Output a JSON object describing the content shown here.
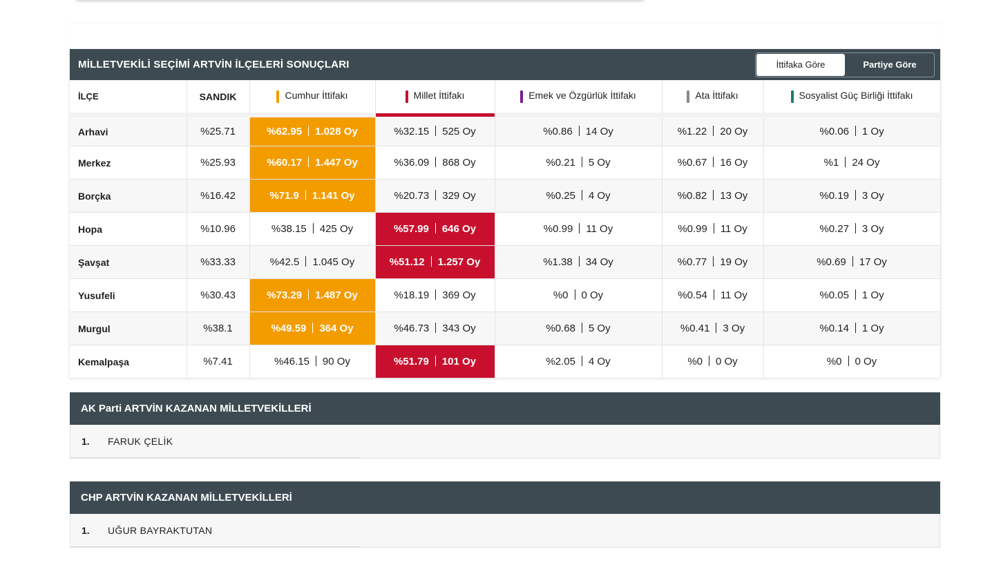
{
  "results": {
    "title": "MİLLETVEKİLİ SEÇİMİ ARTVİN İLÇELERİ SONUÇLARI",
    "toggle": [
      "İttifaka Göre",
      "Partiye Göre"
    ],
    "columns": {
      "district": "İLÇE",
      "ballot": "SANDIK",
      "alliances": [
        {
          "name": "Cumhur İttifakı",
          "color": "#f39c00"
        },
        {
          "name": "Millet İttifakı",
          "color": "#c8102e"
        },
        {
          "name": "Emek ve Özgürlük İttifakı",
          "color": "#7b1c8c"
        },
        {
          "name": "Ata İttifakı",
          "color": "#8a8a8a"
        },
        {
          "name": "Sosyalist Güç Birliği İttifakı",
          "color": "#1e7b6a"
        }
      ]
    },
    "rows": [
      {
        "name": "Arhavi",
        "ballot": "%25.71",
        "winner": 0,
        "cells": [
          [
            "%62.95",
            "1.028 Oy"
          ],
          [
            "%32.15",
            "525 Oy"
          ],
          [
            "%0.86",
            "14 Oy"
          ],
          [
            "%1.22",
            "20 Oy"
          ],
          [
            "%0.06",
            "1 Oy"
          ]
        ]
      },
      {
        "name": "Merkez",
        "ballot": "%25.93",
        "winner": 0,
        "cells": [
          [
            "%60.17",
            "1.447 Oy"
          ],
          [
            "%36.09",
            "868 Oy"
          ],
          [
            "%0.21",
            "5 Oy"
          ],
          [
            "%0.67",
            "16 Oy"
          ],
          [
            "%1",
            "24 Oy"
          ]
        ]
      },
      {
        "name": "Borçka",
        "ballot": "%16.42",
        "winner": 0,
        "cells": [
          [
            "%71.9",
            "1.141 Oy"
          ],
          [
            "%20.73",
            "329 Oy"
          ],
          [
            "%0.25",
            "4 Oy"
          ],
          [
            "%0.82",
            "13 Oy"
          ],
          [
            "%0.19",
            "3 Oy"
          ]
        ]
      },
      {
        "name": "Hopa",
        "ballot": "%10.96",
        "winner": 1,
        "cells": [
          [
            "%38.15",
            "425 Oy"
          ],
          [
            "%57.99",
            "646 Oy"
          ],
          [
            "%0.99",
            "11 Oy"
          ],
          [
            "%0.99",
            "11 Oy"
          ],
          [
            "%0.27",
            "3 Oy"
          ]
        ]
      },
      {
        "name": "Şavşat",
        "ballot": "%33.33",
        "winner": 1,
        "cells": [
          [
            "%42.5",
            "1.045 Oy"
          ],
          [
            "%51.12",
            "1.257 Oy"
          ],
          [
            "%1.38",
            "34 Oy"
          ],
          [
            "%0.77",
            "19 Oy"
          ],
          [
            "%0.69",
            "17 Oy"
          ]
        ]
      },
      {
        "name": "Yusufeli",
        "ballot": "%30.43",
        "winner": 0,
        "cells": [
          [
            "%73.29",
            "1.487 Oy"
          ],
          [
            "%18.19",
            "369 Oy"
          ],
          [
            "%0",
            "0 Oy"
          ],
          [
            "%0.54",
            "11 Oy"
          ],
          [
            "%0.05",
            "1 Oy"
          ]
        ]
      },
      {
        "name": "Murgul",
        "ballot": "%38.1",
        "winner": 0,
        "cells": [
          [
            "%49.59",
            "364 Oy"
          ],
          [
            "%46.73",
            "343 Oy"
          ],
          [
            "%0.68",
            "5 Oy"
          ],
          [
            "%0.41",
            "3 Oy"
          ],
          [
            "%0.14",
            "1 Oy"
          ]
        ]
      },
      {
        "name": "Kemalpaşa",
        "ballot": "%7.41",
        "winner": 1,
        "cells": [
          [
            "%46.15",
            "90 Oy"
          ],
          [
            "%51.79",
            "101 Oy"
          ],
          [
            "%2.05",
            "4 Oy"
          ],
          [
            "%0",
            "0 Oy"
          ],
          [
            "%0",
            "0 Oy"
          ]
        ]
      }
    ]
  },
  "mp_sections": [
    {
      "title": "AK Parti ARTVİN KAZANAN MİLLETVEKİLLERİ",
      "members": [
        {
          "num": "1.",
          "name": "FARUK ÇELİK"
        }
      ]
    },
    {
      "title": "CHP ARTVİN KAZANAN MİLLETVEKİLLERİ",
      "members": [
        {
          "num": "1.",
          "name": "UĞUR BAYRAKTUTAN"
        }
      ]
    }
  ]
}
